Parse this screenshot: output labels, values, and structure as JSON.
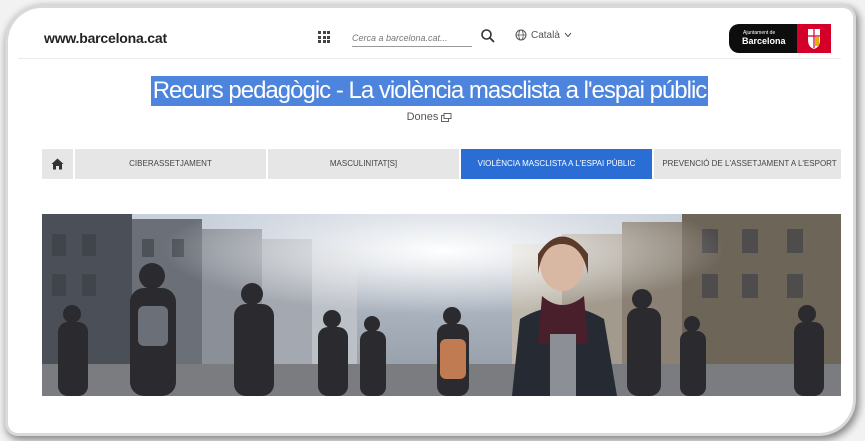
{
  "header": {
    "site_url": "www.barcelona.cat",
    "search_placeholder": "Cerca a barcelona.cat...",
    "language": "Català",
    "brand_small": "Ajuntament de",
    "brand_big": "Barcelona"
  },
  "page": {
    "title": "Recurs pedagògic - La violència masclista a l'espai públic",
    "subtitle": "Dones"
  },
  "nav": {
    "items": [
      {
        "label": "CIBERASSETJAMENT"
      },
      {
        "label": "MASCULINITAT[S]"
      },
      {
        "label": "VIOLÈNCIA MASCLISTA A L'ESPAI PÚBLIC"
      },
      {
        "label": "PREVENCIÓ DE L'ASSETJAMENT A L'ESPORT"
      }
    ],
    "active_index": 2
  },
  "colors": {
    "accent": "#2a6ed5",
    "title_highlight": "#4d84dd",
    "brand_red": "#d4002a"
  }
}
